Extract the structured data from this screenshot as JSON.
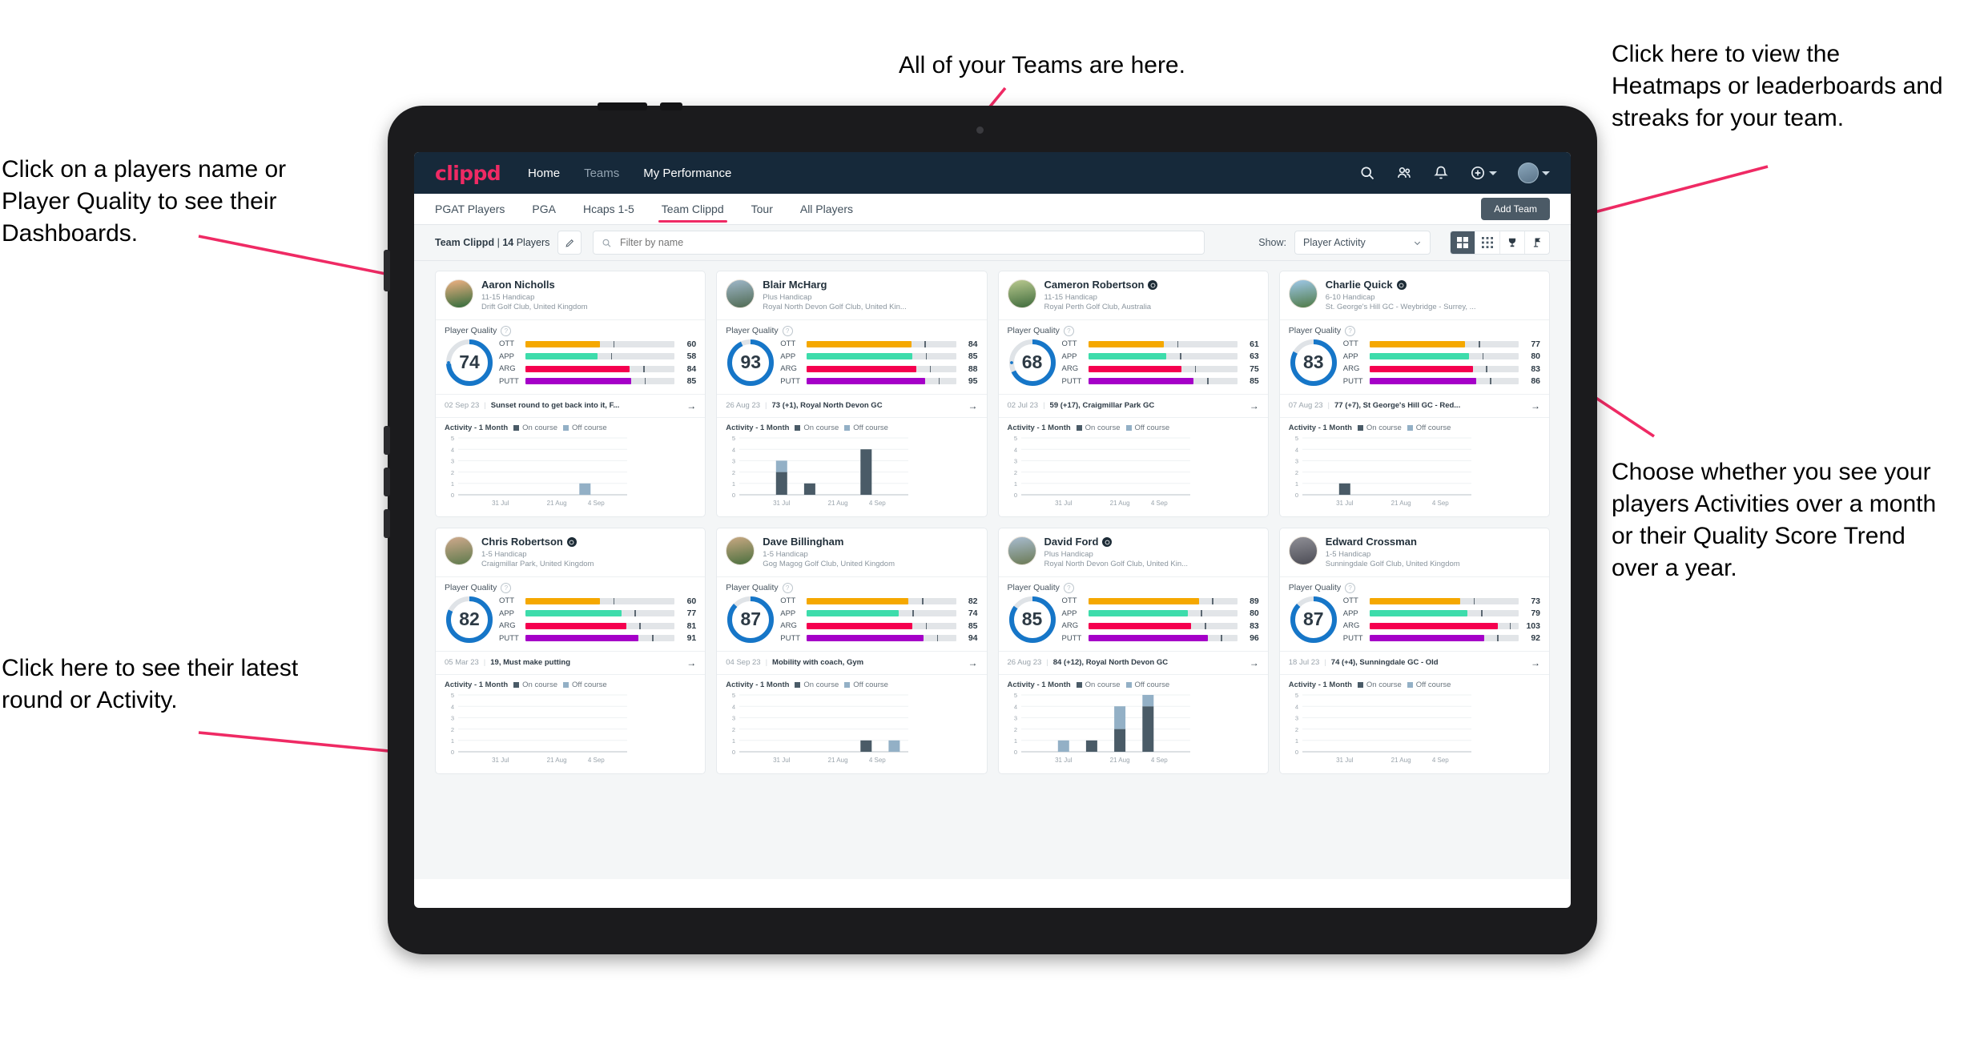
{
  "annotations": [
    {
      "id": "players-name",
      "text": "Click on a players name or Player Quality to see their Dashboards."
    },
    {
      "id": "teams",
      "text": "All of your Teams are here."
    },
    {
      "id": "heatmaps",
      "text": "Click here to view the Heatmaps or leaderboards and streaks for your team."
    },
    {
      "id": "activity-toggle",
      "text": "Choose whether you see your players Activities over a month or their Quality Score Trend over a year."
    },
    {
      "id": "latest-round",
      "text": "Click here to see their latest round or Activity."
    }
  ],
  "app": {
    "brand": "clippd",
    "nav": [
      {
        "label": "Home",
        "active": true
      },
      {
        "label": "Teams",
        "active": false
      },
      {
        "label": "My Performance",
        "active": true
      }
    ],
    "nav_icons": [
      "search-icon",
      "people-icon",
      "bell-icon",
      "plus-circle-icon",
      "avatar"
    ],
    "tabs": [
      {
        "label": "PGAT Players",
        "active": false
      },
      {
        "label": "PGA",
        "active": false
      },
      {
        "label": "Hcaps 1-5",
        "active": false
      },
      {
        "label": "Team Clippd",
        "active": true
      },
      {
        "label": "Tour",
        "active": false
      },
      {
        "label": "All Players",
        "active": false
      }
    ],
    "add_team_label": "Add Team",
    "filter_bar": {
      "team_name": "Team Clippd",
      "separator": "|",
      "player_count": "14",
      "players_word": "Players",
      "search_placeholder": "Filter by name",
      "search_value": "",
      "show_label": "Show:",
      "show_value": "Player Activity",
      "view_buttons": [
        "grid-large-icon",
        "grid-small-icon",
        "trophy-icon",
        "flag-icon"
      ],
      "active_view": "grid-large-icon"
    },
    "card_labels": {
      "player_quality": "Player Quality",
      "activity": "Activity - 1 Month",
      "legend_on": "On course",
      "legend_off": "Off course",
      "metrics": [
        "OTT",
        "APP",
        "ARG",
        "PUTT"
      ]
    },
    "colors": {
      "brand_pink": "#ef2a64",
      "navbar": "#16293a",
      "ott": "#f5a800",
      "app": "#3ddcab",
      "arg": "#f5004f",
      "putt": "#a500c8",
      "ring": "#1676c8",
      "on_course": "#4a5b67",
      "off_course": "#93b0c6",
      "annotation_arrow": "#ef2a64"
    }
  },
  "players": [
    {
      "name": "Aaron Nicholls",
      "verified": false,
      "handicap": "11-15 Handicap",
      "club": "Drift Golf Club, United Kingdom",
      "quality": 74,
      "metrics": [
        {
          "label": "OTT",
          "value": 60
        },
        {
          "label": "APP",
          "value": 58
        },
        {
          "label": "ARG",
          "value": 84
        },
        {
          "label": "PUTT",
          "value": 85
        }
      ],
      "round": {
        "date": "02 Sep 23",
        "text": "Sunset round to get back into it, F..."
      },
      "chart_data": {
        "type": "bar",
        "title": "Activity - 1 Month",
        "ylim": [
          0,
          5
        ],
        "yticks": [
          0,
          1,
          2,
          3,
          4,
          5
        ],
        "xlabels": [
          "31 Jul",
          "21 Aug",
          "4 Sep"
        ],
        "series": [
          {
            "name": "On course",
            "values": [
              0,
              0,
              0,
              0,
              0,
              0
            ]
          },
          {
            "name": "Off course",
            "values": [
              0,
              0,
              0,
              0,
              1,
              0
            ]
          }
        ]
      }
    },
    {
      "name": "Blair McHarg",
      "verified": false,
      "handicap": "Plus Handicap",
      "club": "Royal North Devon Golf Club, United Kin...",
      "quality": 93,
      "metrics": [
        {
          "label": "OTT",
          "value": 84
        },
        {
          "label": "APP",
          "value": 85
        },
        {
          "label": "ARG",
          "value": 88
        },
        {
          "label": "PUTT",
          "value": 95
        }
      ],
      "round": {
        "date": "26 Aug 23",
        "text": "73 (+1), Royal North Devon GC"
      },
      "chart_data": {
        "type": "bar",
        "title": "Activity - 1 Month",
        "ylim": [
          0,
          5
        ],
        "yticks": [
          0,
          1,
          2,
          3,
          4,
          5
        ],
        "xlabels": [
          "31 Jul",
          "21 Aug",
          "4 Sep"
        ],
        "series": [
          {
            "name": "On course",
            "values": [
              0,
              2,
              1,
              0,
              4,
              0
            ]
          },
          {
            "name": "Off course",
            "values": [
              0,
              1,
              0,
              0,
              0,
              0
            ]
          }
        ]
      }
    },
    {
      "name": "Cameron Robertson",
      "verified": true,
      "handicap": "11-15 Handicap",
      "club": "Royal Perth Golf Club, Australia",
      "quality": 68,
      "metrics": [
        {
          "label": "OTT",
          "value": 61
        },
        {
          "label": "APP",
          "value": 63
        },
        {
          "label": "ARG",
          "value": 75
        },
        {
          "label": "PUTT",
          "value": 85
        }
      ],
      "round": {
        "date": "02 Jul 23",
        "text": "59 (+17), Craigmillar Park GC"
      },
      "chart_data": {
        "type": "bar",
        "title": "Activity - 1 Month",
        "ylim": [
          0,
          5
        ],
        "yticks": [
          0,
          1,
          2,
          3,
          4,
          5
        ],
        "xlabels": [
          "31 Jul",
          "21 Aug",
          "4 Sep"
        ],
        "series": [
          {
            "name": "On course",
            "values": [
              0,
              0,
              0,
              0,
              0,
              0
            ]
          },
          {
            "name": "Off course",
            "values": [
              0,
              0,
              0,
              0,
              0,
              0
            ]
          }
        ]
      }
    },
    {
      "name": "Charlie Quick",
      "verified": true,
      "handicap": "6-10 Handicap",
      "club": "St. George's Hill GC - Weybridge - Surrey, ...",
      "quality": 83,
      "metrics": [
        {
          "label": "OTT",
          "value": 77
        },
        {
          "label": "APP",
          "value": 80
        },
        {
          "label": "ARG",
          "value": 83
        },
        {
          "label": "PUTT",
          "value": 86
        }
      ],
      "round": {
        "date": "07 Aug 23",
        "text": "77 (+7), St George's Hill GC - Red..."
      },
      "chart_data": {
        "type": "bar",
        "title": "Activity - 1 Month",
        "ylim": [
          0,
          5
        ],
        "yticks": [
          0,
          1,
          2,
          3,
          4,
          5
        ],
        "xlabels": [
          "31 Jul",
          "21 Aug",
          "4 Sep"
        ],
        "series": [
          {
            "name": "On course",
            "values": [
              0,
              1,
              0,
              0,
              0,
              0
            ]
          },
          {
            "name": "Off course",
            "values": [
              0,
              0,
              0,
              0,
              0,
              0
            ]
          }
        ]
      }
    },
    {
      "name": "Chris Robertson",
      "verified": true,
      "handicap": "1-5 Handicap",
      "club": "Craigmillar Park, United Kingdom",
      "quality": 82,
      "metrics": [
        {
          "label": "OTT",
          "value": 60
        },
        {
          "label": "APP",
          "value": 77
        },
        {
          "label": "ARG",
          "value": 81
        },
        {
          "label": "PUTT",
          "value": 91
        }
      ],
      "round": {
        "date": "05 Mar 23",
        "text": "19, Must make putting"
      },
      "chart_data": {
        "type": "bar",
        "title": "Activity - 1 Month",
        "ylim": [
          0,
          5
        ],
        "yticks": [
          0,
          1,
          2,
          3,
          4,
          5
        ],
        "xlabels": [
          "31 Jul",
          "21 Aug",
          "4 Sep"
        ],
        "series": [
          {
            "name": "On course",
            "values": [
              0,
              0,
              0,
              0,
              0,
              0
            ]
          },
          {
            "name": "Off course",
            "values": [
              0,
              0,
              0,
              0,
              0,
              0
            ]
          }
        ]
      }
    },
    {
      "name": "Dave Billingham",
      "verified": false,
      "handicap": "1-5 Handicap",
      "club": "Gog Magog Golf Club, United Kingdom",
      "quality": 87,
      "metrics": [
        {
          "label": "OTT",
          "value": 82
        },
        {
          "label": "APP",
          "value": 74
        },
        {
          "label": "ARG",
          "value": 85
        },
        {
          "label": "PUTT",
          "value": 94
        }
      ],
      "round": {
        "date": "04 Sep 23",
        "text": "Mobility with coach, Gym"
      },
      "chart_data": {
        "type": "bar",
        "title": "Activity - 1 Month",
        "ylim": [
          0,
          5
        ],
        "yticks": [
          0,
          1,
          2,
          3,
          4,
          5
        ],
        "xlabels": [
          "31 Jul",
          "21 Aug",
          "4 Sep"
        ],
        "series": [
          {
            "name": "On course",
            "values": [
              0,
              0,
              0,
              0,
              1,
              0
            ]
          },
          {
            "name": "Off course",
            "values": [
              0,
              0,
              0,
              0,
              0,
              1
            ]
          }
        ]
      }
    },
    {
      "name": "David Ford",
      "verified": true,
      "handicap": "Plus Handicap",
      "club": "Royal North Devon Golf Club, United Kin...",
      "quality": 85,
      "metrics": [
        {
          "label": "OTT",
          "value": 89
        },
        {
          "label": "APP",
          "value": 80
        },
        {
          "label": "ARG",
          "value": 83
        },
        {
          "label": "PUTT",
          "value": 96
        }
      ],
      "round": {
        "date": "26 Aug 23",
        "text": "84 (+12), Royal North Devon GC"
      },
      "chart_data": {
        "type": "bar",
        "title": "Activity - 1 Month",
        "ylim": [
          0,
          5
        ],
        "yticks": [
          0,
          1,
          2,
          3,
          4,
          5
        ],
        "xlabels": [
          "31 Jul",
          "21 Aug",
          "4 Sep"
        ],
        "series": [
          {
            "name": "On course",
            "values": [
              0,
              0,
              1,
              2,
              4,
              0
            ]
          },
          {
            "name": "Off course",
            "values": [
              0,
              1,
              0,
              2,
              1,
              0
            ]
          }
        ]
      }
    },
    {
      "name": "Edward Crossman",
      "verified": false,
      "handicap": "1-5 Handicap",
      "club": "Sunningdale Golf Club, United Kingdom",
      "quality": 87,
      "metrics": [
        {
          "label": "OTT",
          "value": 73
        },
        {
          "label": "APP",
          "value": 79
        },
        {
          "label": "ARG",
          "value": 103
        },
        {
          "label": "PUTT",
          "value": 92
        }
      ],
      "round": {
        "date": "18 Jul 23",
        "text": "74 (+4), Sunningdale GC - Old"
      },
      "chart_data": {
        "type": "bar",
        "title": "Activity - 1 Month",
        "ylim": [
          0,
          5
        ],
        "yticks": [
          0,
          1,
          2,
          3,
          4,
          5
        ],
        "xlabels": [
          "31 Jul",
          "21 Aug",
          "4 Sep"
        ],
        "series": [
          {
            "name": "On course",
            "values": [
              0,
              0,
              0,
              0,
              0,
              0
            ]
          },
          {
            "name": "Off course",
            "values": [
              0,
              0,
              0,
              0,
              0,
              0
            ]
          }
        ]
      }
    }
  ]
}
